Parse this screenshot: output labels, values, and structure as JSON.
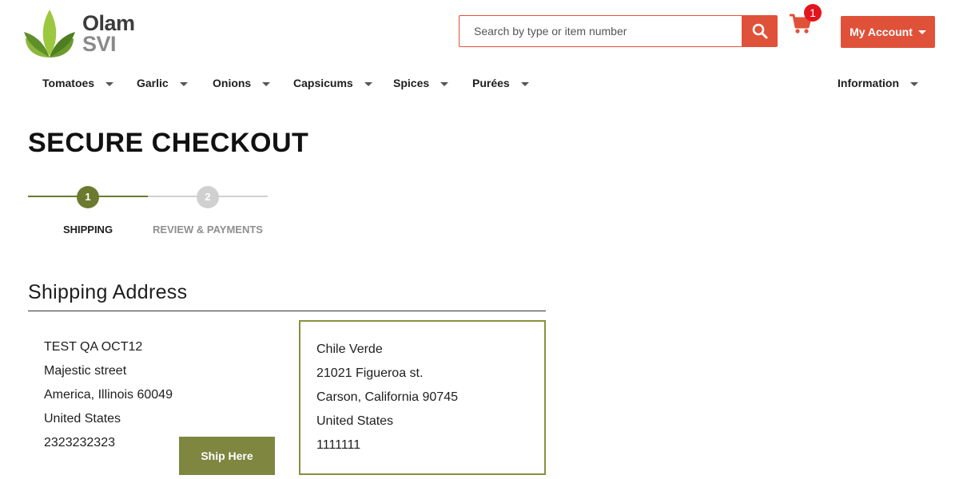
{
  "brand": {
    "name_line1": "Olam",
    "name_line2": "SVI"
  },
  "header": {
    "search_placeholder": "Search by type or item number",
    "cart_count": "1",
    "account_label": "My Account"
  },
  "nav": {
    "items": [
      {
        "label": "Tomatoes"
      },
      {
        "label": "Garlic"
      },
      {
        "label": "Onions"
      },
      {
        "label": "Capsicums"
      },
      {
        "label": "Spices"
      },
      {
        "label": "Purées"
      },
      {
        "label": "Information"
      }
    ]
  },
  "page": {
    "title": "SECURE CHECKOUT"
  },
  "progress": {
    "steps": [
      {
        "number": "1",
        "label": "SHIPPING",
        "state": "active"
      },
      {
        "number": "2",
        "label": "REVIEW & PAYMENTS",
        "state": "pending"
      }
    ]
  },
  "shipping": {
    "heading": "Shipping Address",
    "addresses": [
      {
        "lines": [
          "TEST QA OCT12",
          "Majestic street",
          "America, Illinois 60049",
          "United States",
          "2323232323"
        ],
        "selected": false
      },
      {
        "lines": [
          "Chile Verde",
          "21021 Figueroa st.",
          "Carson, California 90745",
          "United States",
          "1111111"
        ],
        "selected": true
      }
    ],
    "ship_here_label": "Ship Here"
  },
  "colors": {
    "accent": "#e0513a",
    "brand_green": "#6b7a2e",
    "button_olive": "#7e8640",
    "badge_red": "#e4141b"
  }
}
